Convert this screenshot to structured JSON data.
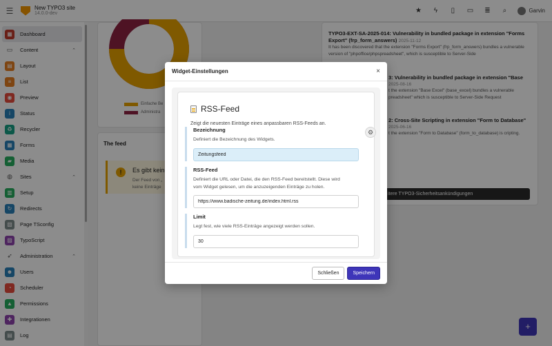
{
  "topbar": {
    "site_name": "New TYPO3 site",
    "site_version": "14.0.0-dev",
    "user_name": "Garvin",
    "icons": [
      "star-icon",
      "bolt-icon",
      "document-icon",
      "file-icon",
      "list-icon",
      "search-icon",
      "avatar"
    ]
  },
  "sidebar": {
    "items": [
      {
        "label": "Dashboard",
        "kind": "item",
        "color": "#c0392b",
        "icon": "dashboard-icon",
        "active": true
      },
      {
        "label": "Content",
        "kind": "group",
        "icon": "file-icon"
      },
      {
        "label": "Layout",
        "kind": "item",
        "color": "#e67e22",
        "icon": "layout-icon"
      },
      {
        "label": "List",
        "kind": "item",
        "color": "#e67e22",
        "icon": "list-icon"
      },
      {
        "label": "Preview",
        "kind": "item",
        "color": "#e74c3c",
        "icon": "eye-icon"
      },
      {
        "label": "Status",
        "kind": "item",
        "color": "#2980b9",
        "icon": "info-icon"
      },
      {
        "label": "Recycler",
        "kind": "item",
        "color": "#16a085",
        "icon": "trash-icon"
      },
      {
        "label": "Forms",
        "kind": "item",
        "color": "#2980b9",
        "icon": "form-icon"
      },
      {
        "label": "Media",
        "kind": "item",
        "color": "#27ae60",
        "icon": "folder-icon"
      },
      {
        "label": "Sites",
        "kind": "group",
        "icon": "globe-icon"
      },
      {
        "label": "Setup",
        "kind": "item",
        "color": "#27ae60",
        "icon": "setup-icon"
      },
      {
        "label": "Redirects",
        "kind": "item",
        "color": "#2980b9",
        "icon": "redirect-icon"
      },
      {
        "label": "Page TSconfig",
        "kind": "item",
        "color": "#7f8c8d",
        "icon": "tsconfig-icon"
      },
      {
        "label": "TypoScript",
        "kind": "item",
        "color": "#8e44ad",
        "icon": "typoscript-icon"
      },
      {
        "label": "Administration",
        "kind": "group",
        "icon": "rocket-icon"
      },
      {
        "label": "Users",
        "kind": "item",
        "color": "#2980b9",
        "icon": "users-icon"
      },
      {
        "label": "Scheduler",
        "kind": "item",
        "color": "#e74c3c",
        "icon": "clock-icon"
      },
      {
        "label": "Permissions",
        "kind": "item",
        "color": "#27ae60",
        "icon": "lock-icon"
      },
      {
        "label": "Integrationen",
        "kind": "item",
        "color": "#8e44ad",
        "icon": "plug-icon"
      },
      {
        "label": "Log",
        "kind": "item",
        "color": "#7f8c8d",
        "icon": "log-icon"
      }
    ]
  },
  "dashboard": {
    "legend": [
      {
        "label": "Einfache Be",
        "color": "#e8a200"
      },
      {
        "label": "Administra",
        "color": "#8e2443"
      }
    ],
    "feed_title": "The feed",
    "notice_title": "Es gibt keine",
    "notice_body_1": "Der Feed von „",
    "notice_body_2": "keine Einträge",
    "security": [
      {
        "title": "TYPO3-EXT-SA-2025-014: Vulnerability in bundled package in extension \"Forms Export\" (frp_form_answers)",
        "date": "2025-11-12",
        "body": "It has been discovered that the extension \"Forms Export\" (frp_form_answers) bundles a vulnerable version of \"phpoffice/phpspreadsheet\", which is susceptible to Server-Side"
      },
      {
        "title": "3: Vulnerability in bundled package in extension \"Base",
        "date": "2025-08-16",
        "body": "t the extension \"Base Excel\" (base_excel) bundles a vulnerable preadsheet\" which is susceptible to Server-Side Request"
      },
      {
        "title": "2: Cross-Site Scripting in extension \"Form to Database\"",
        "date": "2025-06-16",
        "body": "t the extension \"Form to Database\" (form_to_database) is cripting."
      }
    ],
    "more_button": "itere TYPO3-Sicherheitsankündigungen"
  },
  "modal": {
    "title": "Widget-Einstellungen",
    "close_glyph": "×",
    "panel_title": "RSS-Feed",
    "panel_subtitle": "Zeigt die neuesten Einträge eines anpassbaren RSS-Feeds an.",
    "fields": {
      "name": {
        "label": "Bezeichnung",
        "desc": "Definiert die Bezeichnung des Widgets.",
        "value": "Zeitungsfeed"
      },
      "feed": {
        "label": "RSS-Feed",
        "desc_1": "Definiert die URL oder Datei, die den RSS-Feed bereitstellt. Diese wird",
        "desc_2": "vom Widget gelesen, um die anzuzeigenden Einträge zu holen.",
        "value": "https://www.badische-zeitung.de/index.html.rss"
      },
      "limit": {
        "label": "Limit",
        "desc": "Legt fest, wie viele RSS-Einträge angezeigt werden sollen.",
        "value": "30"
      }
    },
    "close_button": "Schließen",
    "save_button": "Speichern"
  },
  "colors": {
    "accent": "#3e35b9",
    "warning": "#e8a200",
    "active_input": "#dbeef9"
  }
}
